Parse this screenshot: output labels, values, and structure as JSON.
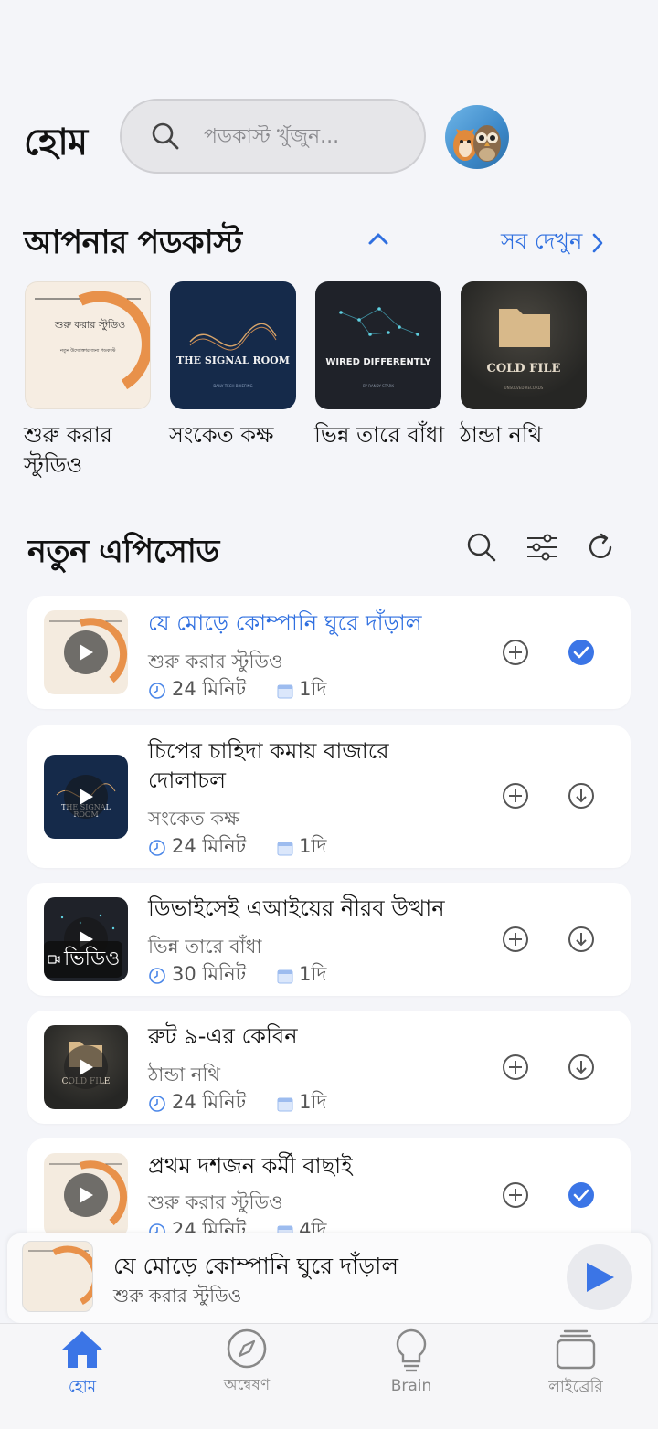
{
  "header": {
    "title": "হোম",
    "search_placeholder": "পডকাস্ট খুঁজুন..."
  },
  "podcasts_section": {
    "title": "আপনার পডকাস্ট",
    "see_all": "সব দেখুন",
    "items": [
      {
        "label": "শুরু করার স্টুডিও",
        "art_title": "শুরু করার স্টুডিও",
        "art_sub": "নতুন উদ্যোক্তার জন্য পডকাস্ট"
      },
      {
        "label": "সংকেত কক্ষ",
        "art_title": "THE SIGNAL ROOM",
        "art_sub": "DAILY TECH BRIEFING"
      },
      {
        "label": "ভিন্ন তারে বাঁধা",
        "art_title": "WIRED DIFFERENTLY",
        "art_sub": "BY RANDY STARK"
      },
      {
        "label": "ঠান্ডা নথি",
        "art_title": "COLD FILE",
        "art_sub": "UNSOLVED RECORDS"
      }
    ]
  },
  "episodes_section": {
    "title": "নতুন এপিসোড",
    "items": [
      {
        "title": "যে মোড়ে কোম্পানি ঘুরে দাঁড়াল",
        "podcast": "শুরু করার স্টুডিও",
        "duration": "24 মিনিট",
        "age": "1দি",
        "state": "done"
      },
      {
        "title": "চিপের চাহিদা কমায় বাজারে দোলাচল",
        "podcast": "সংকেত কক্ষ",
        "duration": "24 মিনিট",
        "age": "1দি",
        "state": "download"
      },
      {
        "title": "ডিভাইসেই এআইয়ের নীরব উত্থান",
        "podcast": "ভিন্ন তারে বাঁধা",
        "duration": "30 মিনিট",
        "age": "1দি",
        "state": "download",
        "badge": "ভিডিও"
      },
      {
        "title": "রুট ৯-এর কেবিন",
        "podcast": "ঠান্ডা নথি",
        "duration": "24 মিনিট",
        "age": "1দি",
        "state": "download"
      },
      {
        "title": "প্রথম দশজন কর্মী বাছাই",
        "podcast": "শুরু করার স্টুডিও",
        "duration": "24 মিনিট",
        "age": "4দি",
        "state": "done"
      }
    ]
  },
  "mini_player": {
    "title": "যে মোড়ে কোম্পানি ঘুরে দাঁড়াল",
    "podcast": "শুরু করার স্টুডিও"
  },
  "tabs": [
    {
      "label": "হোম",
      "icon": "home-icon",
      "active": true
    },
    {
      "label": "অন্বেষণ",
      "icon": "compass-icon",
      "active": false
    },
    {
      "label": "Brain",
      "icon": "lightbulb-icon",
      "active": false
    },
    {
      "label": "লাইব্রেরি",
      "icon": "library-icon",
      "active": false
    }
  ],
  "colors": {
    "accent": "#2f6fe0",
    "done_check": "#3b75e6"
  }
}
